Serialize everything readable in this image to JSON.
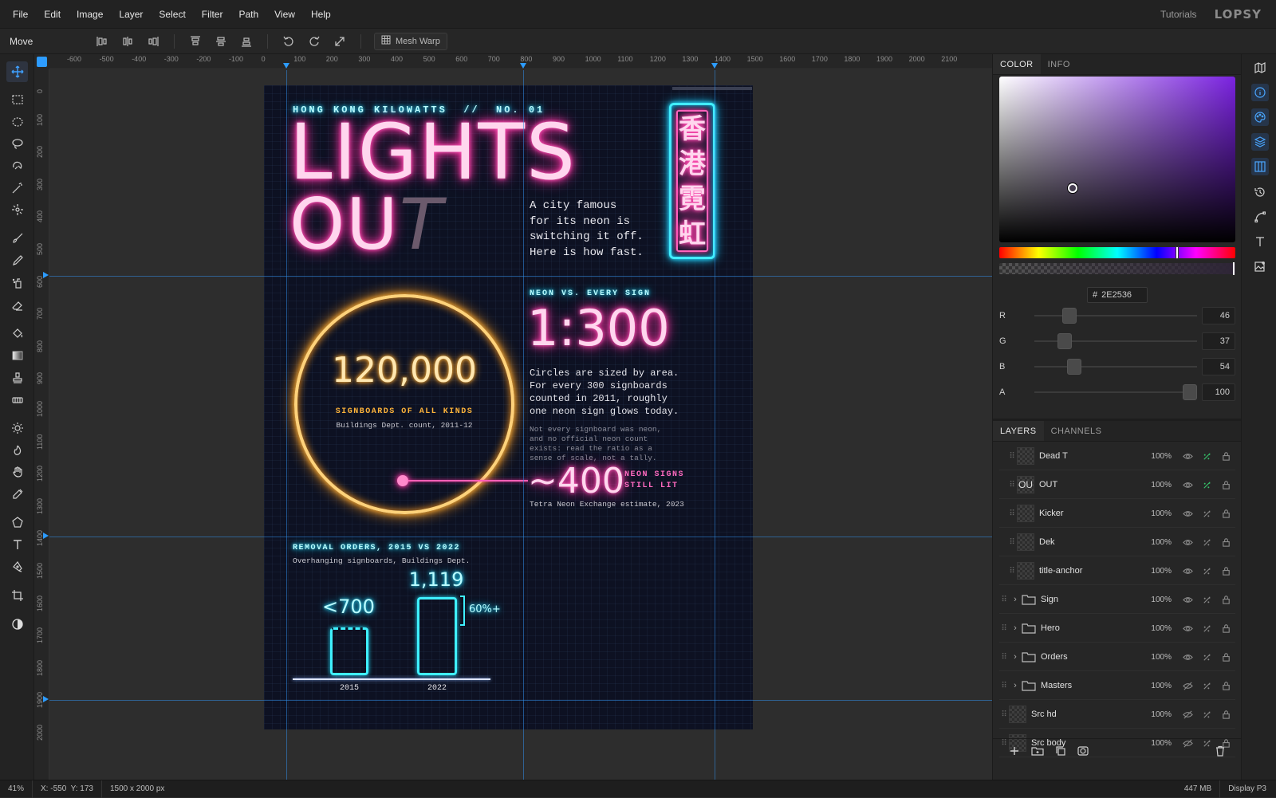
{
  "menubar": {
    "items": [
      "File",
      "Edit",
      "Image",
      "Layer",
      "Select",
      "Filter",
      "Path",
      "View",
      "Help"
    ],
    "tutorials": "Tutorials",
    "logo": "LOPSY"
  },
  "options": {
    "tool_name": "Move",
    "mesh_warp": "Mesh Warp"
  },
  "ruler": {
    "top_labels": [
      "-600",
      "-500",
      "-400",
      "-300",
      "-200",
      "-100",
      "0",
      "100",
      "200",
      "300",
      "400",
      "500",
      "600",
      "700",
      "800",
      "900",
      "1000",
      "1100",
      "1200",
      "1300",
      "1400",
      "1500",
      "1600",
      "1700",
      "1800",
      "1900",
      "2000",
      "2100"
    ],
    "left_labels": [
      "0",
      "100",
      "200",
      "300",
      "400",
      "500",
      "600",
      "700",
      "800",
      "900",
      "1000",
      "1100",
      "1200",
      "1300",
      "1400",
      "1500",
      "1600",
      "1700",
      "1800",
      "1900",
      "2000"
    ]
  },
  "poster": {
    "kicker": "HONG KONG KILOWATTS  //  NO. 01",
    "title_line1": "LIGHTS",
    "title_line2": "OU",
    "title_dead": "T",
    "dek": [
      "A city famous",
      "for its neon is",
      "switching it off.",
      "Here is how fast."
    ],
    "sign_chars": [
      "香",
      "港",
      "霓",
      "虹"
    ],
    "hero_number": "120,000",
    "hero_label": "SIGNBOARDS OF ALL KINDS",
    "hero_source": "Buildings Dept. count, 2011-12",
    "ratio_kicker": "NEON VS. EVERY SIGN",
    "ratio": "1:300",
    "ratio_body": [
      "Circles are sized by area.",
      "For every 300 signboards",
      "counted in 2011, roughly",
      "one neon sign glows today."
    ],
    "ratio_note": [
      "Not every signboard was neon,",
      "and no official neon count",
      "exists: read the ratio as a",
      "sense of scale, not a tally."
    ],
    "neon_number": "~400",
    "neon_label_1": "NEON SIGNS",
    "neon_label_2": "STILL LIT",
    "neon_source": "Tetra Neon Exchange estimate, 2023",
    "orders_title": "REMOVAL ORDERS, 2015 VS 2022",
    "orders_sub": "Overhanging signboards, Buildings Dept.",
    "bar_2015_value": "<700",
    "bar_2022_value": "1,119",
    "bar_increase": "60%+",
    "bar_2015_year": "2015",
    "bar_2022_year": "2022"
  },
  "panel": {
    "tabs": [
      "COLOR",
      "INFO"
    ],
    "hex_prefix": "#",
    "hex": "2E2536",
    "channels": [
      {
        "label": "R",
        "value": "46"
      },
      {
        "label": "G",
        "value": "37"
      },
      {
        "label": "B",
        "value": "54"
      },
      {
        "label": "A",
        "value": "100"
      }
    ],
    "layer_tabs": [
      "LAYERS",
      "CHANNELS"
    ],
    "layers": [
      {
        "name": "Dead T",
        "opacity": "100%",
        "type": "layer",
        "visible": true,
        "fx": true
      },
      {
        "name": "OUT",
        "opacity": "100%",
        "type": "layer",
        "visible": true,
        "fx": true,
        "thumb": "OU"
      },
      {
        "name": "Kicker",
        "opacity": "100%",
        "type": "layer",
        "visible": true,
        "fx": false
      },
      {
        "name": "Dek",
        "opacity": "100%",
        "type": "layer",
        "visible": true,
        "fx": false
      },
      {
        "name": "title-anchor",
        "opacity": "100%",
        "type": "layer",
        "visible": true,
        "fx": false
      },
      {
        "name": "Sign",
        "opacity": "100%",
        "type": "group",
        "visible": true,
        "fx": false
      },
      {
        "name": "Hero",
        "opacity": "100%",
        "type": "group",
        "visible": true,
        "fx": false
      },
      {
        "name": "Orders",
        "opacity": "100%",
        "type": "group",
        "visible": true,
        "fx": false
      },
      {
        "name": "Masters",
        "opacity": "100%",
        "type": "group",
        "visible": false,
        "fx": false
      },
      {
        "name": "Src hd",
        "opacity": "100%",
        "type": "layer",
        "visible": false,
        "fx": false
      },
      {
        "name": "Src body",
        "opacity": "100%",
        "type": "layer",
        "visible": false,
        "fx": false
      }
    ]
  },
  "status": {
    "zoom": "41%",
    "coords": "X: -550  Y: 173",
    "size": "1500 x 2000 px",
    "memory": "447 MB",
    "profile": "Display P3"
  },
  "colors": {
    "accent": "#2d9cff",
    "neon_pink": "#ff3aa8",
    "neon_cyan": "#22e3ff",
    "neon_yellow": "#ffb43a",
    "current_color": "#2E2536"
  }
}
